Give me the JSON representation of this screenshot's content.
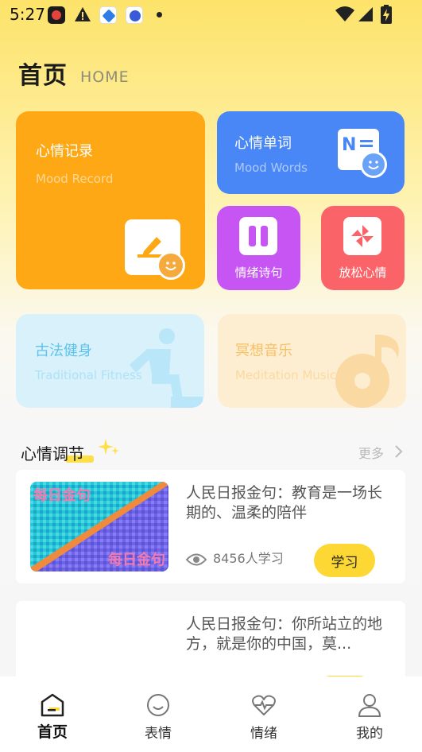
{
  "status_bar": {
    "time": "5:27"
  },
  "header": {
    "title": "首页",
    "subtitle": "HOME"
  },
  "cards": {
    "mood_record": {
      "title": "心情记录",
      "subtitle": "Mood Record",
      "color": "#fea816"
    },
    "mood_words": {
      "title": "心情单词",
      "subtitle": "Mood Words",
      "color": "#4887f5"
    },
    "emotion_poems": {
      "title": "情绪诗句",
      "color": "#c655f4"
    },
    "relax_mood": {
      "title": "放松心情",
      "color": "#fa6469"
    },
    "traditional_fitness": {
      "title": "古法健身",
      "subtitle": "Traditional Fitness",
      "color": "#d8f1fb"
    },
    "meditation_music": {
      "title": "冥想音乐",
      "subtitle": "Meditation Music",
      "color": "#fdeed2"
    }
  },
  "section": {
    "title": "心情调节",
    "more": "更多"
  },
  "list": [
    {
      "title": "人民日报金句：教育是一场长期的、温柔的陪伴",
      "views": "8456人学习",
      "button": "学习",
      "thumb_text": "每日金句"
    },
    {
      "title": "人民日报金句：你所站立的地方，就是你的中国，莫..."
    }
  ],
  "nav": [
    {
      "label": "首页",
      "icon": "home-icon",
      "active": true
    },
    {
      "label": "表情",
      "icon": "smile-icon",
      "active": false
    },
    {
      "label": "情绪",
      "icon": "heart-pulse-icon",
      "active": false
    },
    {
      "label": "我的",
      "icon": "user-icon",
      "active": false
    }
  ],
  "colors": {
    "accent": "#fdd835"
  }
}
